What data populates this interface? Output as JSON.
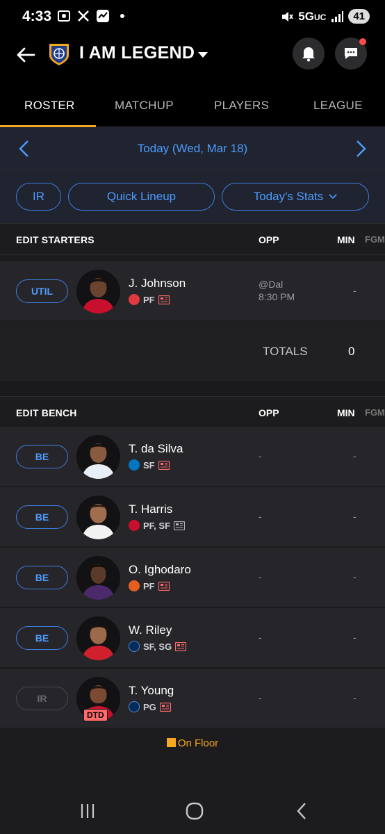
{
  "status_bar": {
    "time": "4:33",
    "network": "5G",
    "network_sub": "UC",
    "battery": "41"
  },
  "header": {
    "team_name": "I AM LEGEND"
  },
  "tabs": [
    {
      "label": "ROSTER",
      "active": true
    },
    {
      "label": "MATCHUP",
      "active": false
    },
    {
      "label": "PLAYERS",
      "active": false
    },
    {
      "label": "LEAGUE",
      "active": false
    }
  ],
  "date_nav": {
    "label": "Today (Wed, Mar 18)"
  },
  "actions": {
    "ir": "IR",
    "quick_lineup": "Quick Lineup",
    "todays_stats": "Today's Stats"
  },
  "starters": {
    "title": "EDIT STARTERS",
    "col_opp": "OPP",
    "col_min": "MIN",
    "col_fgm": "FGM",
    "players": [
      {
        "slot": "UTIL",
        "name": "J. Johnson",
        "positions": "PF",
        "opp_line1": "@Dal",
        "opp_line2": "8:30 PM",
        "min": "-",
        "team_color": "#e03a3e"
      }
    ],
    "totals_label": "TOTALS",
    "totals_value": "0"
  },
  "bench": {
    "title": "EDIT BENCH",
    "col_opp": "OPP",
    "col_min": "MIN",
    "col_fgm": "FGM",
    "players": [
      {
        "slot": "BE",
        "name": "T. da Silva",
        "positions": "SF",
        "opp": "-",
        "min": "-",
        "team_color": "#0077c0"
      },
      {
        "slot": "BE",
        "name": "T. Harris",
        "positions": "PF, SF",
        "opp": "-",
        "min": "-",
        "team_color": "#c8102e"
      },
      {
        "slot": "BE",
        "name": "O. Ighodaro",
        "positions": "PF",
        "opp": "-",
        "min": "-",
        "team_color": "#e56020"
      },
      {
        "slot": "BE",
        "name": "W. Riley",
        "positions": "SF, SG",
        "opp": "-",
        "min": "-",
        "team_color": "#002b5c"
      },
      {
        "slot": "IR",
        "name": "T. Young",
        "positions": "PG",
        "opp": "-",
        "min": "-",
        "team_color": "#002b5c",
        "status": "DTD"
      }
    ]
  },
  "legend": {
    "on_floor": "On Floor"
  },
  "colors": {
    "accent": "#4f9bff",
    "tab_underline": "#f5a623",
    "background": "#1c1c1e"
  }
}
